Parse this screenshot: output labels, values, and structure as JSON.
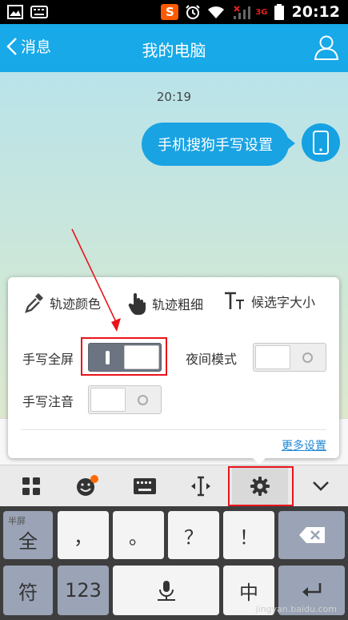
{
  "status_bar": {
    "time": "20:12",
    "sogou_label": "S",
    "network_label": "3G",
    "icons": [
      "image-icon",
      "keyboard-icon",
      "sogou-icon",
      "alarm-icon",
      "wifi-icon",
      "signal-icon",
      "battery-icon"
    ]
  },
  "header": {
    "back_label": "消息",
    "title": "我的电脑"
  },
  "chat": {
    "timestamp": "20:19",
    "messages": [
      {
        "text": "手机搜狗手写设置",
        "direction": "outgoing"
      }
    ]
  },
  "popup": {
    "options": [
      {
        "label": "轨迹颜色",
        "icon": "dropper-icon"
      },
      {
        "label": "轨迹粗细",
        "icon": "hand-pointer-icon"
      },
      {
        "label": "候选字大小",
        "icon": "text-size-icon"
      }
    ],
    "fullscreen_label": "手写全屏",
    "fullscreen_on": true,
    "night_label": "夜间模式",
    "night_on": false,
    "phonetic_label": "手写注音",
    "phonetic_on": false,
    "more_label": "更多设置"
  },
  "toolbar": {
    "items": [
      "grid-icon",
      "emoji-icon",
      "keyboard-icon",
      "cursor-icon",
      "settings-icon",
      "chevron-down-icon"
    ],
    "active_index": 4
  },
  "keyboard": {
    "row1": {
      "fullwidth_main": "全",
      "fullwidth_sub": "半屏",
      "comma": "，",
      "period": "。",
      "question": "？",
      "exclaim": "！"
    },
    "row2": {
      "symbols": "符",
      "numbers": "123",
      "lang": "中"
    }
  },
  "watermark": "jingyan.baidu.com",
  "colors": {
    "accent": "#17a9e8",
    "annotation": "#e8141b"
  }
}
